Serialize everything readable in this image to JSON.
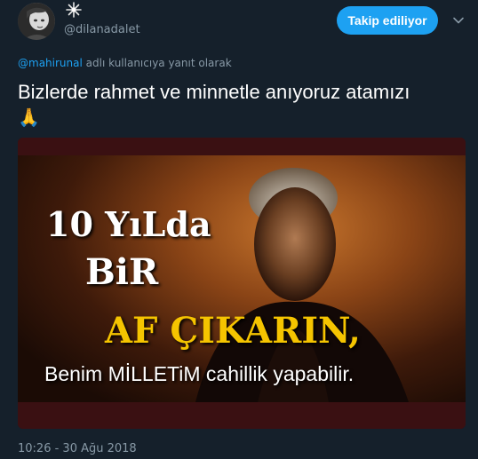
{
  "user": {
    "handle": "@dilanadalet",
    "avatar_icon": "profile-avatar",
    "badge_icon": "sparkle-icon"
  },
  "follow_button": {
    "label": "Takip ediliyor",
    "color": "#1da1f2"
  },
  "menu_icon": "chevron-down-icon",
  "reply_context": {
    "mention": "@mahirunal",
    "suffix": "adlı kullanıcıya yanıt olarak"
  },
  "tweet": {
    "text": "Bizlerde rahmet ve minnetle anıyoruz atamızı",
    "emoji": "🙏"
  },
  "media": {
    "line1": "10 YıLda",
    "line2": "BiR",
    "line3": "AF ÇIKARIN,",
    "line4": "Benim MİLLETiM cahillik yapabilir.",
    "highlight_color": "#f5c400"
  },
  "timestamp": "10:26 - 30 Ağu 2018",
  "theme": {
    "background": "#15202b",
    "secondary_text": "#8899a6",
    "link": "#1da1f2"
  }
}
